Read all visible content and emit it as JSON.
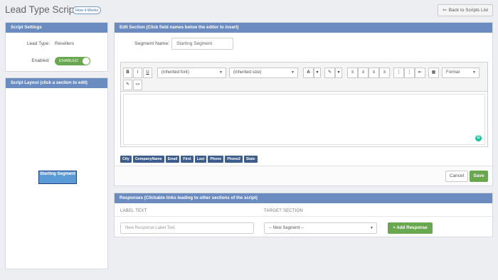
{
  "header": {
    "title": "Lead Type Scripts",
    "how_it_works": "How it Works",
    "back_button": "Back to Scripts List",
    "back_icon": "arrow-left-icon"
  },
  "settings": {
    "title": "Script Settings",
    "lead_type_label": "Lead Type:",
    "lead_type_value": "Resellers",
    "enabled_label": "Enabled:",
    "enabled_toggle": "ENABLED",
    "enabled_state": true
  },
  "layout": {
    "title": "Script Layout (click a section to edit)",
    "segments": [
      "Starting Segment"
    ]
  },
  "edit": {
    "title": "Edit Section (Click field names below the editor to insert)",
    "segment_name_label": "Segment Name:",
    "segment_name_value": "Starting Segment",
    "toolbar": {
      "bold": "B",
      "italic": "I",
      "underline": "U",
      "font": "(inherited font)",
      "size": "(inherited size)",
      "font_color": "A",
      "format": "Format"
    },
    "fields": [
      "City",
      "CompanyName",
      "Email",
      "First",
      "Last",
      "Phone",
      "Phone2",
      "State"
    ],
    "cancel": "Cancel",
    "save": "Save"
  },
  "responses": {
    "title": "Responses (Clickable links leading to other sections of the script)",
    "col_label": "LABEL TEXT",
    "col_target": "TARGET SECTION",
    "label_placeholder": "New Response Label Text",
    "target_value": "-- New Segment --",
    "add_button": "Add Response"
  },
  "colors": {
    "panel_header": "#6b8cc0",
    "success": "#6aa84f",
    "tag": "#3d5d8c",
    "segment_box": "#5b9bd5"
  }
}
